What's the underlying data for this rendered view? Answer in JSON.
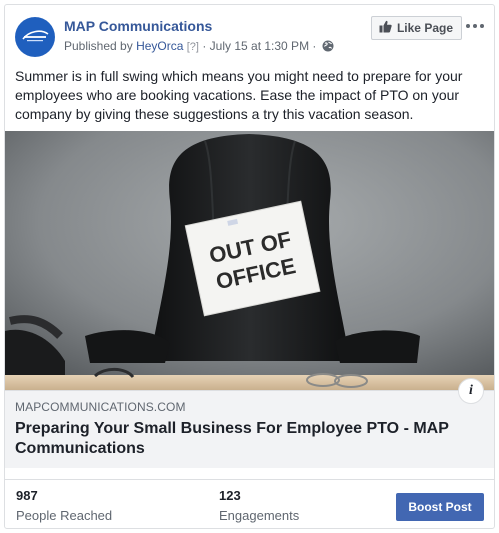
{
  "post": {
    "page_name": "MAP Communications",
    "published_prefix": "Published by",
    "publisher": "HeyOrca",
    "publisher_help": "[?]",
    "separator": "·",
    "date": "July 15 at 1:30 PM",
    "audience_icon": "globe-icon",
    "like_page_label": "Like Page",
    "like_icon": "thumbs-up-icon",
    "more_icon": "more-options-icon",
    "body": "Summer is in full swing which means you might need to prepare for your employees who are booking vacations. Ease the impact of PTO on your company by giving these suggestions a try this vacation season."
  },
  "photo": {
    "sign_line1": "OUT OF",
    "sign_line2": "OFFICE"
  },
  "link_preview": {
    "domain": "MAPCOMMUNICATIONS.COM",
    "title": "Preparing Your Small Business For Employee PTO - MAP Communications",
    "info_icon": "info-icon"
  },
  "insights": {
    "reached_value": "987",
    "reached_label": "People Reached",
    "engagements_value": "123",
    "engagements_label": "Engagements",
    "boost_label": "Boost Post"
  },
  "colors": {
    "brand_link": "#365899",
    "boost_button": "#4267b2",
    "border": "#dddfe2"
  }
}
